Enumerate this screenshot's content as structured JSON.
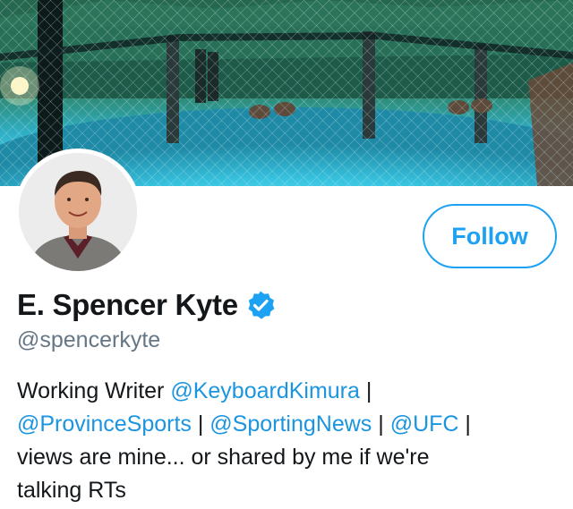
{
  "profile": {
    "display_name": "E. Spencer Kyte",
    "handle": "@spencerkyte",
    "verified": true
  },
  "follow_button": {
    "label": "Follow"
  },
  "bio": {
    "line1_text": "Working Writer ",
    "mention_keyboardkimura": "@KeyboardKimura",
    "sep1": " |",
    "mention_provincesports": "@ProvinceSports",
    "sep2": " | ",
    "mention_sportingnews": "@SportingNews",
    "sep3": " | ",
    "mention_ufc": "@UFC",
    "sep4": " |",
    "line3_text": "views are mine... or shared by me if we're",
    "line4_text": "talking RTs"
  },
  "colors": {
    "accent": "#1da1f2",
    "link": "#1b95e0",
    "handle_gray": "#657786",
    "text": "#14171a"
  },
  "icons": {
    "verified": "verified-badge-icon"
  }
}
